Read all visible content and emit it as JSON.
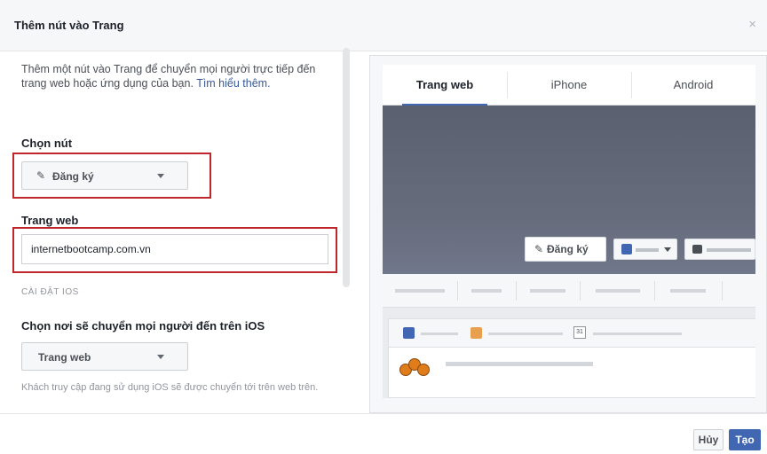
{
  "dialog": {
    "title": "Thêm nút vào Trang",
    "close_icon": "×"
  },
  "form": {
    "intro_text": "Thêm một nút vào Trang để chuyển mọi người trực tiếp đến trang web hoặc ứng dụng của bạn.",
    "learn_more": "Tìm hiểu thêm.",
    "choose_button_label": "Chọn nút",
    "choose_button_value": "Đăng ký",
    "website_label": "Trang web",
    "website_value": "internetbootcamp.com.vn",
    "ios_section": "CÀI ĐẶT IOS",
    "ios_label": "Chọn nơi sẽ chuyển mọi người đến trên iOS",
    "ios_value": "Trang web",
    "ios_helper": "Khách truy cập đang sử dụng iOS sẽ được chuyển tới trên web trên."
  },
  "preview": {
    "tabs": [
      "Trang web",
      "iPhone",
      "Android"
    ],
    "active_tab": 0,
    "cta_label": "Đăng ký",
    "calendar_day": "31"
  },
  "footer": {
    "cancel_label": "Hủy",
    "create_label": "Tạo"
  },
  "colors": {
    "primary": "#4267b2",
    "highlight_box": "#c0272d",
    "cover": "#676d7d"
  }
}
